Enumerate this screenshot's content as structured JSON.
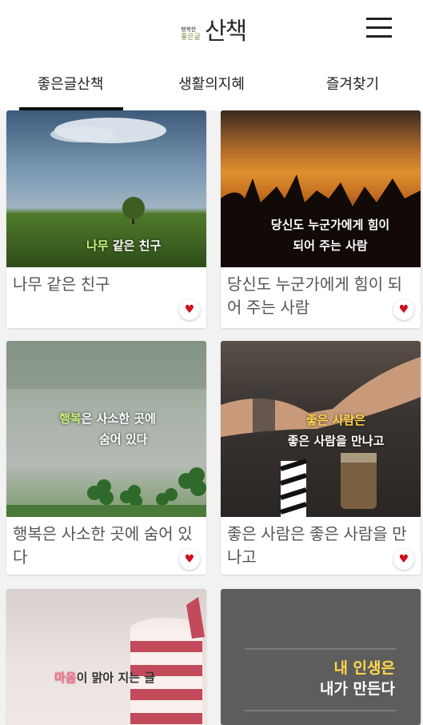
{
  "header": {
    "logo_small": "좋은글",
    "logo_small_top": "행복한",
    "logo_big": "산책",
    "menu_icon": "hamburger-menu-icon"
  },
  "tabs": [
    {
      "label": "좋은글산책",
      "active": true
    },
    {
      "label": "생활의지혜",
      "active": false
    },
    {
      "label": "즐겨찾기",
      "active": false
    }
  ],
  "cards": [
    {
      "title": "나무 같은 친구",
      "overlay_a": "나무",
      "overlay_b": " 같은 친구",
      "favorite_icon": "heart-icon"
    },
    {
      "title": "당신도 누군가에게 힘이 되어 주는 사람",
      "overlay_a": "당신도 누군가에게 힘이",
      "overlay_b": "되어 주는 사람",
      "favorite_icon": "heart-icon"
    },
    {
      "title": "행복은 사소한 곳에 숨어 있다",
      "overlay_a": "행복",
      "overlay_b": "은 사소한 곳에",
      "overlay_c": "숨어 있다",
      "favorite_icon": "heart-icon"
    },
    {
      "title": "좋은 사람은 좋은 사람을 만나고",
      "overlay_a": "좋은 사람은",
      "overlay_b": "좋은 사람을 만나고",
      "favorite_icon": "heart-icon"
    },
    {
      "title": "",
      "overlay_a": "마음",
      "overlay_b": "이 맑아 지는 글"
    },
    {
      "title": "",
      "overlay_a": "내 인생은",
      "overlay_b": "내가 만든다"
    }
  ],
  "colors": {
    "heart": "#d0101e",
    "accent_green": "#c8f07a",
    "accent_yellow": "#ffd84a"
  }
}
